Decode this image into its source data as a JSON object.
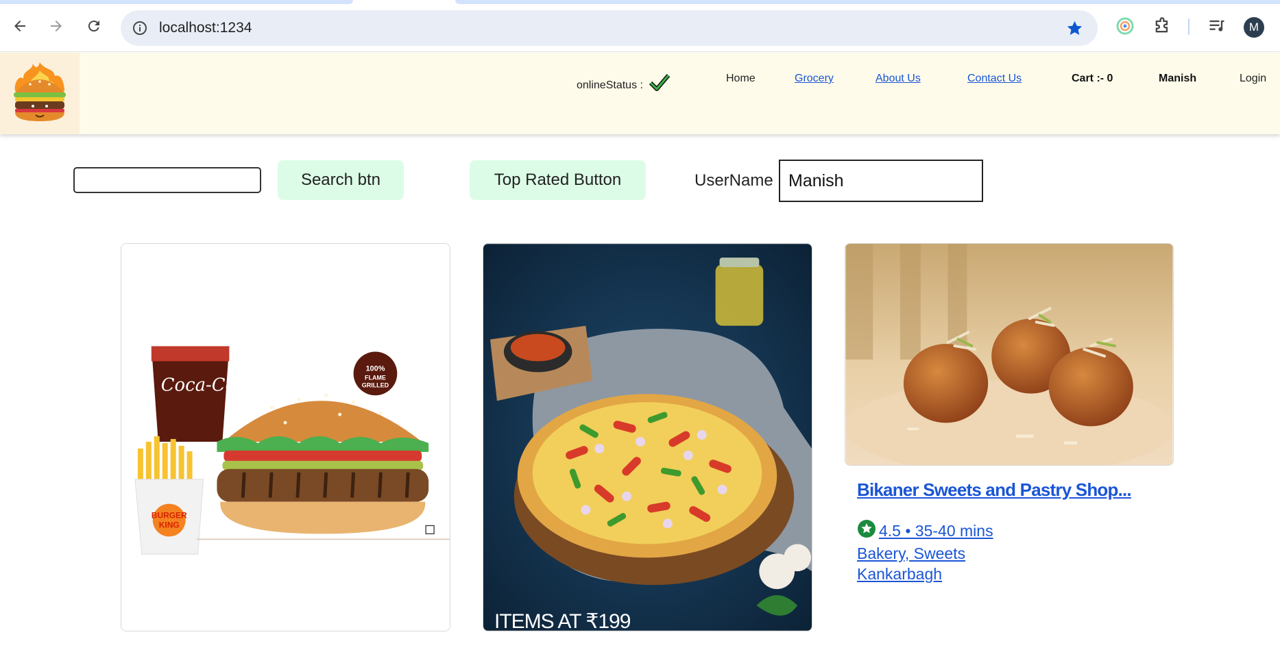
{
  "browser": {
    "url": "localhost:1234",
    "profile_initial": "M",
    "icons": [
      "back-icon",
      "forward-icon",
      "reload-icon",
      "site-info-icon",
      "bookmark-star-icon",
      "extension-circle-icon",
      "puzzle-icon",
      "media-queue-icon"
    ]
  },
  "header": {
    "online_status_label": "onlineStatus :",
    "nav": {
      "home": "Home",
      "grocery": "Grocery",
      "about": "About Us",
      "contact": "Contact Us",
      "cart": "Cart :- 0",
      "user": "Manish",
      "login": "Login"
    },
    "colors": {
      "header_bg": "#fefbea",
      "logo_bg": "#fdf0da",
      "link": "#1a55d6"
    }
  },
  "controls": {
    "search_value": "",
    "search_button": "Search btn",
    "top_rated_button": "Top Rated Button",
    "username_label": "UserName :",
    "username_value": "Manish",
    "button_bg": "#dcfce7"
  },
  "cards": [
    {
      "image": "burger-king-combo",
      "overlay_text": ""
    },
    {
      "image": "veg-pizza",
      "overlay_text": "ITEMS AT ₹199"
    },
    {
      "image": "gulab-jamun",
      "name": "Bikaner Sweets and Pastry Shop...",
      "rating": "4.5 • 35-40 mins",
      "cuisines": "Bakery, Sweets",
      "area": "Kankarbagh"
    }
  ]
}
